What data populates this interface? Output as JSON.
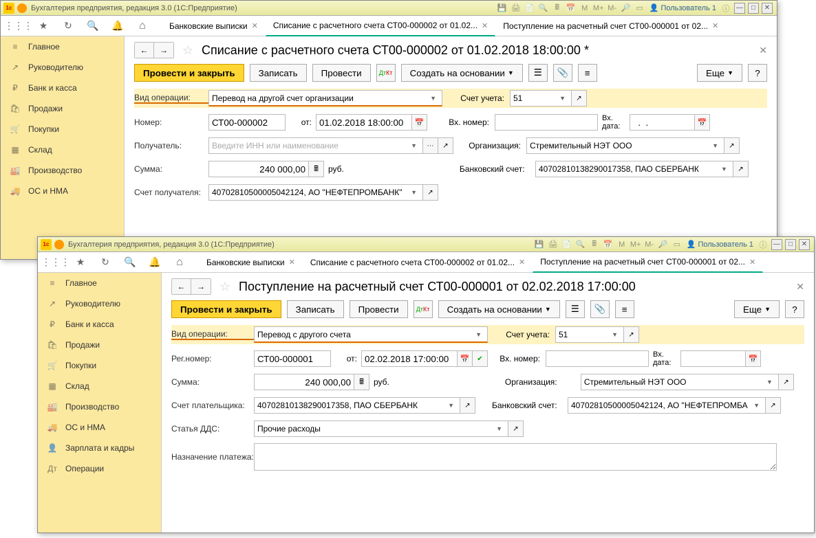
{
  "app_title": "Бухгалтерия предприятия, редакция 3.0  (1С:Предприятие)",
  "user": "Пользователь 1",
  "sidebar": [
    {
      "icon": "≡",
      "label": "Главное"
    },
    {
      "icon": "↗",
      "label": "Руководителю"
    },
    {
      "icon": "₽",
      "label": "Банк и касса"
    },
    {
      "icon": "🛍",
      "label": "Продажи"
    },
    {
      "icon": "🛒",
      "label": "Покупки"
    },
    {
      "icon": "▦",
      "label": "Склад"
    },
    {
      "icon": "🏭",
      "label": "Производство"
    },
    {
      "icon": "🚚",
      "label": "ОС и НМА"
    },
    {
      "icon": "👤",
      "label": "Зарплата и кадры"
    },
    {
      "icon": "Дт",
      "label": "Операции"
    }
  ],
  "w1": {
    "tabs": [
      {
        "label": "Банковские выписки"
      },
      {
        "label": "Списание с расчетного счета СТ00-000002 от 01.02...",
        "active": true
      },
      {
        "label": "Поступление на расчетный счет СТ00-000001 от 02..."
      }
    ],
    "title": "Списание с расчетного счета СТ00-000002 от 01.02.2018 18:00:00 *",
    "buttons": {
      "post_close": "Провести и закрыть",
      "write": "Записать",
      "post": "Провести",
      "create_based": "Создать на основании",
      "more": "Еще"
    },
    "fields": {
      "op_type_lbl": "Вид операции:",
      "op_type": "Перевод на другой счет организации",
      "acct_lbl": "Счет учета:",
      "acct": "51",
      "num_lbl": "Номер:",
      "num": "СТ00-000002",
      "from_lbl": "от:",
      "date": "01.02.2018 18:00:00",
      "in_num_lbl": "Вх. номер:",
      "in_num": "",
      "in_date_lbl": "Вх. дата:",
      "in_date": "  .  .",
      "recv_lbl": "Получатель:",
      "recv_ph": "Введите ИНН или наименование",
      "org_lbl": "Организация:",
      "org": "Стремительный НЭТ ООО",
      "sum_lbl": "Сумма:",
      "sum": "240 000,00",
      "cur": "руб.",
      "bank_lbl": "Банковский счет:",
      "bank": "40702810138290017358, ПАО СБЕРБАНК",
      "recv_acct_lbl": "Счет получателя:",
      "recv_acct": "40702810500005042124, АО \"НЕФТЕПРОМБАНК\""
    }
  },
  "w2": {
    "tabs": [
      {
        "label": "Банковские выписки"
      },
      {
        "label": "Списание с расчетного счета СТ00-000002 от 01.02..."
      },
      {
        "label": "Поступление на расчетный счет СТ00-000001 от 02...",
        "active": true
      }
    ],
    "title": "Поступление на расчетный счет СТ00-000001 от 02.02.2018 17:00:00",
    "buttons": {
      "post_close": "Провести и закрыть",
      "write": "Записать",
      "post": "Провести",
      "create_based": "Создать на основании",
      "more": "Еще"
    },
    "fields": {
      "op_type_lbl": "Вид операции:",
      "op_type": "Перевод с другого счета",
      "acct_lbl": "Счет учета:",
      "acct": "51",
      "num_lbl": "Рег.номер:",
      "num": "СТ00-000001",
      "from_lbl": "от:",
      "date": "02.02.2018 17:00:00",
      "in_num_lbl": "Вх. номер:",
      "in_num": "",
      "in_date_lbl": "Вх. дата:",
      "in_date": "",
      "sum_lbl": "Сумма:",
      "sum": "240 000,00",
      "cur": "руб.",
      "org_lbl": "Организация:",
      "org": "Стремительный НЭТ ООО",
      "payer_lbl": "Счет плательщика:",
      "payer": "40702810138290017358, ПАО СБЕРБАНК",
      "bank_lbl": "Банковский счет:",
      "bank": "40702810500005042124, АО \"НЕФТЕПРОМБА",
      "dds_lbl": "Статья ДДС:",
      "dds": "Прочие расходы",
      "purpose_lbl": "Назначение платежа:"
    }
  }
}
